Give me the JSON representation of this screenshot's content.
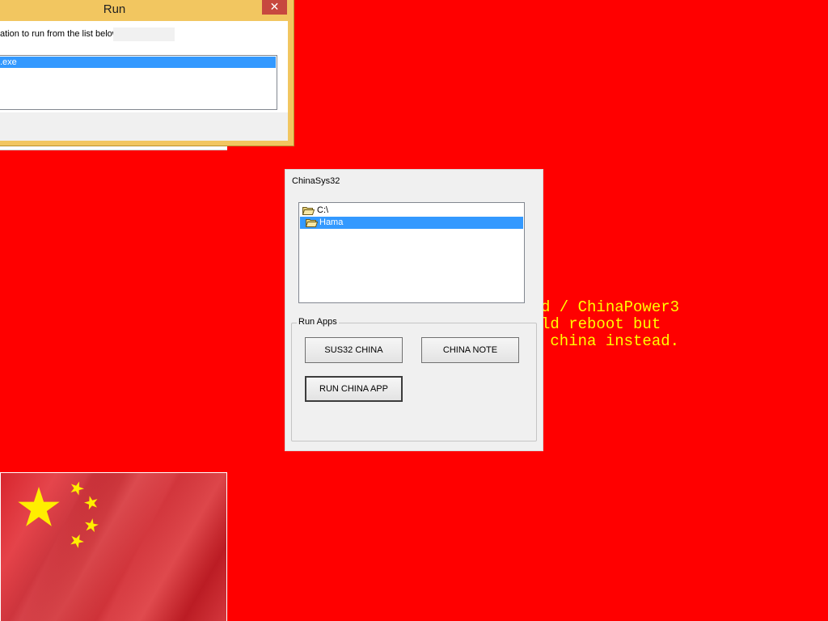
{
  "run_dialog": {
    "title": "Run",
    "close_glyph": "✕",
    "instruction": "ation to run from the list below.",
    "list_items": [
      ".exe"
    ]
  },
  "overlay_text": {
    "lines": [
      "d / ChinaPower3",
      "ld reboot but",
      " china instead."
    ],
    "color": "#ffff00"
  },
  "app": {
    "title": "ChinaSys32",
    "folders": [
      {
        "label": "C:\\",
        "icon": "open-folder-icon",
        "selected": false
      },
      {
        "label": "Hama",
        "icon": "open-folder-icon",
        "selected": true
      }
    ],
    "group_label": "Run Apps",
    "buttons": {
      "sus32": "SUS32 CHINA",
      "note": "CHINA NOTE",
      "run_app": "RUN CHINA APP"
    }
  },
  "desktop": {
    "background_color": "#ff0000",
    "wallpaper_image": "china-flag"
  }
}
